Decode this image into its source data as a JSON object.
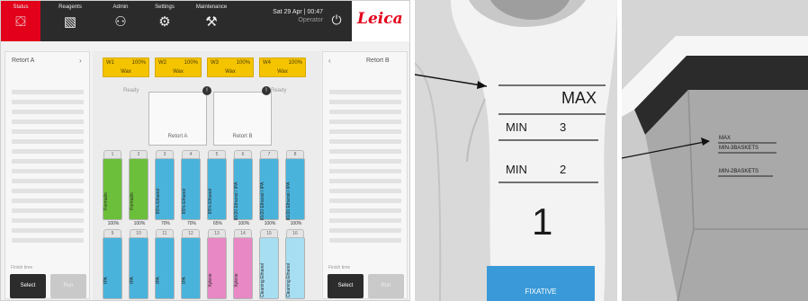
{
  "nav": [
    {
      "label": "Status",
      "icon": "status-icon",
      "glyph": "⛋",
      "active": true
    },
    {
      "label": "Reagents",
      "icon": "reagents-icon",
      "glyph": "▧",
      "active": false
    },
    {
      "label": "Admin",
      "icon": "admin-icon",
      "glyph": "⚇",
      "active": false
    },
    {
      "label": "Settings",
      "icon": "settings-icon",
      "glyph": "⚙",
      "active": false
    },
    {
      "label": "Maintenance",
      "icon": "maintenance-icon",
      "glyph": "⚒",
      "active": false
    }
  ],
  "clock": {
    "datetime": "Sat 29 Apr | 00:47",
    "user": "Operator"
  },
  "brand": {
    "logo": "Leica",
    "accent": "#e2001a"
  },
  "retort_a": {
    "title": "Retort A",
    "chevron": "›",
    "finish_time": "Finish time",
    "select": "Select",
    "run": "Run"
  },
  "retort_b": {
    "title": "Retort B",
    "chevron": "‹",
    "finish_time": "Finish time",
    "select": "Select",
    "run": "Run"
  },
  "wax_baths": [
    {
      "name": "W1",
      "level": "100%",
      "reagent": "Wax"
    },
    {
      "name": "W2",
      "level": "100%",
      "reagent": "Wax"
    },
    {
      "name": "W3",
      "level": "100%",
      "reagent": "Wax"
    },
    {
      "name": "W4",
      "level": "100%",
      "reagent": "Wax"
    }
  ],
  "retort_status": {
    "a": "Ready",
    "b": "Ready",
    "a_label": "Retort A",
    "b_label": "Retort B",
    "badge": "!"
  },
  "bottles_top": [
    {
      "num": "1",
      "name": "Formalin",
      "pct": "100%",
      "color": "#6cbf3a"
    },
    {
      "num": "2",
      "name": "Formalin",
      "pct": "100%",
      "color": "#6cbf3a"
    },
    {
      "num": "3",
      "name": "85% Ethanol",
      "pct": "70%",
      "color": "#4ab3dc"
    },
    {
      "num": "4",
      "name": "85% Ethanol",
      "pct": "70%",
      "color": "#4ab3dc"
    },
    {
      "num": "5",
      "name": "85% Ethanol",
      "pct": "65%",
      "color": "#4ab3dc"
    },
    {
      "num": "6",
      "name": "80/20 Ethanol / IPA",
      "pct": "100%",
      "color": "#4ab3dc"
    },
    {
      "num": "7",
      "name": "80/20 Ethanol / IPA",
      "pct": "100%",
      "color": "#4ab3dc"
    },
    {
      "num": "8",
      "name": "80/20 Ethanol / IPA",
      "pct": "100%",
      "color": "#4ab3dc"
    }
  ],
  "bottles_bottom": [
    {
      "num": "9",
      "name": "IPA",
      "pct": "100%",
      "color": "#4ab3dc"
    },
    {
      "num": "10",
      "name": "IPA",
      "pct": "100%",
      "color": "#4ab3dc"
    },
    {
      "num": "11",
      "name": "IPA",
      "pct": "100%",
      "color": "#4ab3dc"
    },
    {
      "num": "12",
      "name": "IPA",
      "pct": "100%",
      "color": "#4ab3dc"
    },
    {
      "num": "13",
      "name": "Xylene",
      "pct": "100%",
      "color": "#e889c5"
    },
    {
      "num": "14",
      "name": "Xylene",
      "pct": "100%",
      "color": "#e889c5"
    },
    {
      "num": "15",
      "name": "Cleaning Ethanol",
      "pct": "100%",
      "color": "#a7def2"
    },
    {
      "num": "16",
      "name": "Cleaning Ethanol",
      "pct": "100%",
      "color": "#a7def2"
    }
  ],
  "bottle_photo": {
    "max": "MAX",
    "min": "MIN",
    "min_three": "3",
    "min_two": "2",
    "number": "1",
    "label": "FIXATIVE",
    "label_color": "#3a9ad9"
  },
  "retort_photo": {
    "max": "MAX",
    "min3": "MIN-3BASKETS",
    "min2": "MIN-2BASKETS"
  }
}
